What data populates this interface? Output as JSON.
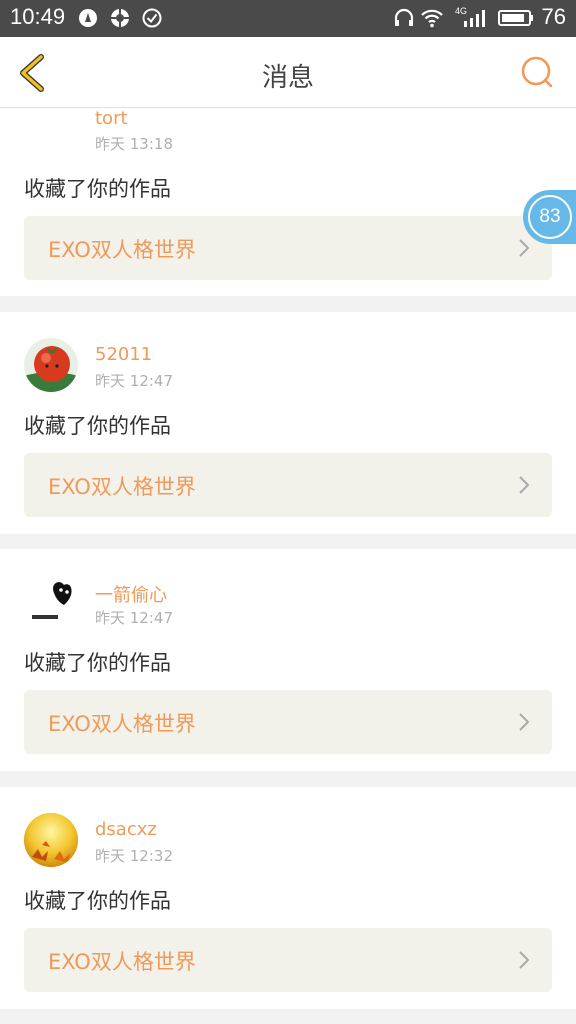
{
  "status_bar": {
    "time": "10:49",
    "battery": "76",
    "network": "4G"
  },
  "nav": {
    "title": "消息",
    "back_icon": "chevron-left-icon",
    "search_icon": "search-icon"
  },
  "floating_badge": {
    "count": "83"
  },
  "messages": [
    {
      "username": "tort",
      "time": "昨天 13:18",
      "action": "收藏了你的作品",
      "work_title": "EXO双人格世界",
      "avatar": "avatar"
    },
    {
      "username": "52011",
      "time": "昨天 12:47",
      "action": "收藏了你的作品",
      "work_title": "EXO双人格世界",
      "avatar": "tomato-avatar"
    },
    {
      "username": "一箭偷心",
      "time": "昨天 12:47",
      "action": "收藏了你的作品",
      "work_title": "EXO双人格世界",
      "avatar": "heart-avatar"
    },
    {
      "username": "dsacxz",
      "time": "昨天 12:32",
      "action": "收藏了你的作品",
      "work_title": "EXO双人格世界",
      "avatar": "autumn-leaves-avatar"
    }
  ],
  "colors": {
    "accent": "#f09a5a",
    "back_icon": "#f0c020",
    "badge": "#66b8e8",
    "status_bar": "#4a4a4a"
  }
}
